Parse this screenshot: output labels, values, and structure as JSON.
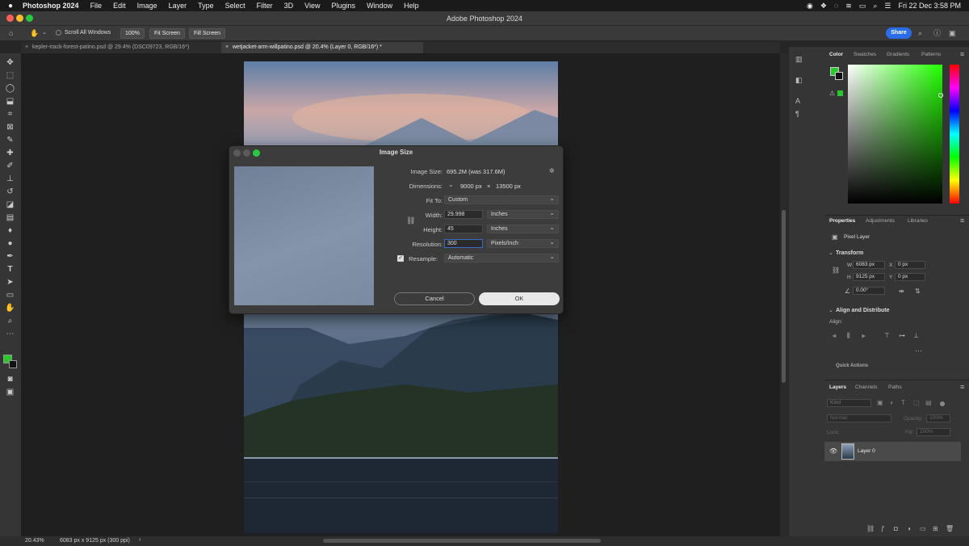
{
  "menubar": {
    "app": "Photoshop 2024",
    "items": [
      "File",
      "Edit",
      "Image",
      "Layer",
      "Type",
      "Select",
      "Filter",
      "3D",
      "View",
      "Plugins",
      "Window",
      "Help"
    ],
    "datetime": "Fri 22 Dec  3:58 PM"
  },
  "window": {
    "title": "Adobe Photoshop 2024"
  },
  "options": {
    "scroll_all": "Scroll All Windows",
    "zoom100": "100%",
    "fit_screen": "Fit Screen",
    "fill_screen": "Fill Screen",
    "share": "Share"
  },
  "tabs": [
    {
      "label": "kepler-track-forest-patino.psd @ 29.4% (DSC09723, RGB/16*)",
      "active": false
    },
    {
      "label": "wetjacket-arm-willpatino.psd @ 20.4% (Layer 0, RGB/16*) *",
      "active": true
    }
  ],
  "dialog": {
    "title": "Image Size",
    "image_size_label": "Image Size:",
    "image_size_value": "695.2M (was 317.6M)",
    "dimensions_label": "Dimensions:",
    "dim_w": "9000 px",
    "dim_x": "×",
    "dim_h": "13500 px",
    "fit_to_label": "Fit To:",
    "fit_to_value": "Custom",
    "width_label": "Width:",
    "width_value": "29.998",
    "width_unit": "Inches",
    "height_label": "Height:",
    "height_value": "45",
    "height_unit": "Inches",
    "resolution_label": "Resolution:",
    "resolution_value": "300",
    "resolution_unit": "Pixels/Inch",
    "resample_label": "Resample:",
    "resample_value": "Automatic",
    "resample_checked": true,
    "cancel": "Cancel",
    "ok": "OK"
  },
  "panels": {
    "color_tabs": [
      "Color",
      "Swatches",
      "Gradients",
      "Patterns"
    ],
    "props_tabs": [
      "Properties",
      "Adjustments",
      "Libraries"
    ],
    "pixel_layer": "Pixel Layer",
    "transform": "Transform",
    "w_label": "W",
    "w_value": "6083 px",
    "x_label": "X",
    "x_value": "0 px",
    "h_label": "H",
    "h_value": "9125 px",
    "y_label": "Y",
    "y_value": "0 px",
    "angle": "0.00°",
    "align": "Align and Distribute",
    "align_sub": "Align:",
    "quick": "Quick Actions",
    "layers_tabs": [
      "Layers",
      "Channels",
      "Paths"
    ],
    "kind": "Kind",
    "blend": "Normal",
    "opacity_label": "Opacity:",
    "opacity": "100%",
    "lock": "Lock:",
    "fill_label": "Fill:",
    "fill": "100%",
    "layer_name": "Layer 0"
  },
  "status": {
    "zoom": "20.43%",
    "info": "6083 px x 9125 px (300 ppi)"
  },
  "colors": {
    "fg": "#29c92b",
    "accent": "#2b6de8"
  }
}
